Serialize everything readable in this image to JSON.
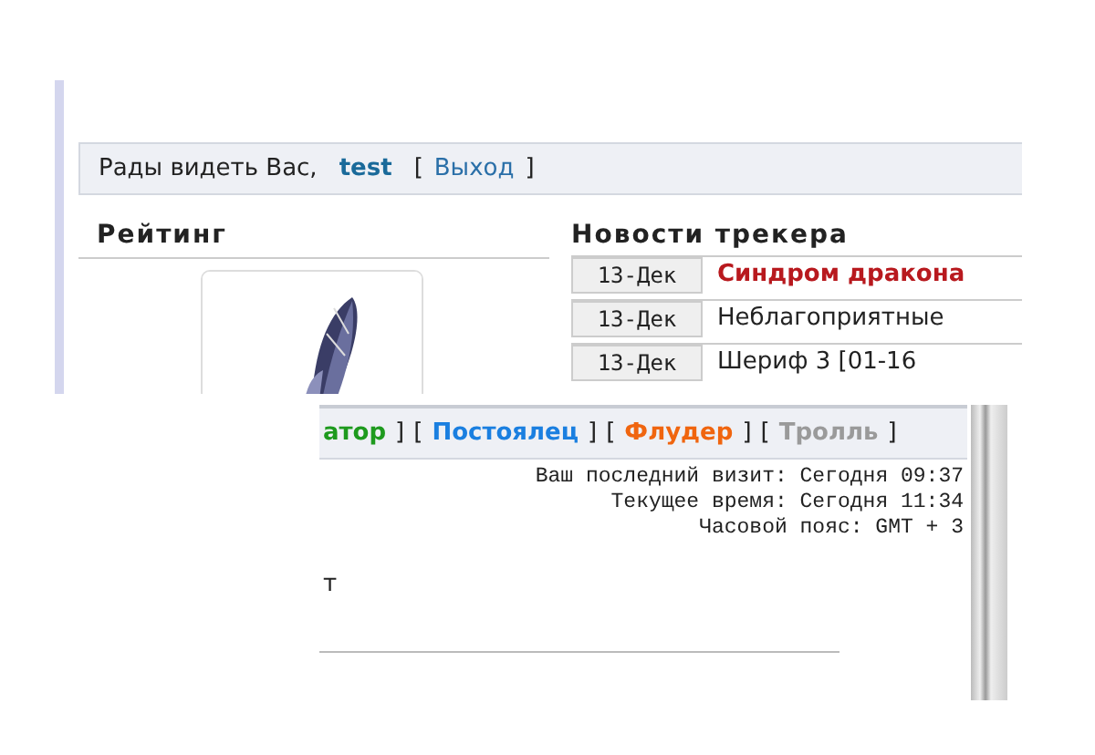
{
  "greeting": {
    "text": "Рады видеть Вас,",
    "user": "test",
    "open": "[",
    "logout": "Выход",
    "close": "]"
  },
  "rating": {
    "title": "Рейтинг"
  },
  "news": {
    "title": "Новости трекера",
    "rows": [
      {
        "date": "13-Дек",
        "title": "Синдром дракона",
        "hot": true
      },
      {
        "date": "13-Дек",
        "title": "Неблагоприятные",
        "hot": false
      },
      {
        "date": "13-Дек",
        "title": "Шериф 3 [01-16",
        "hot": false
      }
    ]
  },
  "role_bar": [
    {
      "kind": "role",
      "text": "атор",
      "color": "#1e9a1e"
    },
    {
      "kind": "bracket",
      "text": "]"
    },
    {
      "kind": "bracket",
      "text": "["
    },
    {
      "kind": "role",
      "text": "Постоялец",
      "color": "#1a7fe0"
    },
    {
      "kind": "bracket",
      "text": "]"
    },
    {
      "kind": "bracket",
      "text": "["
    },
    {
      "kind": "role",
      "text": "Флудер",
      "color": "#f0650f"
    },
    {
      "kind": "bracket",
      "text": "]"
    },
    {
      "kind": "bracket",
      "text": "["
    },
    {
      "kind": "role",
      "text": "Тролль",
      "color": "#9a9a9a"
    },
    {
      "kind": "bracket",
      "text": "]"
    }
  ],
  "visit_info": [
    "Ваш последний визит: Сегодня 09:37",
    "Текущее время: Сегодня 11:34",
    "Часовой пояс: GMT + 3"
  ],
  "fragment": "т"
}
